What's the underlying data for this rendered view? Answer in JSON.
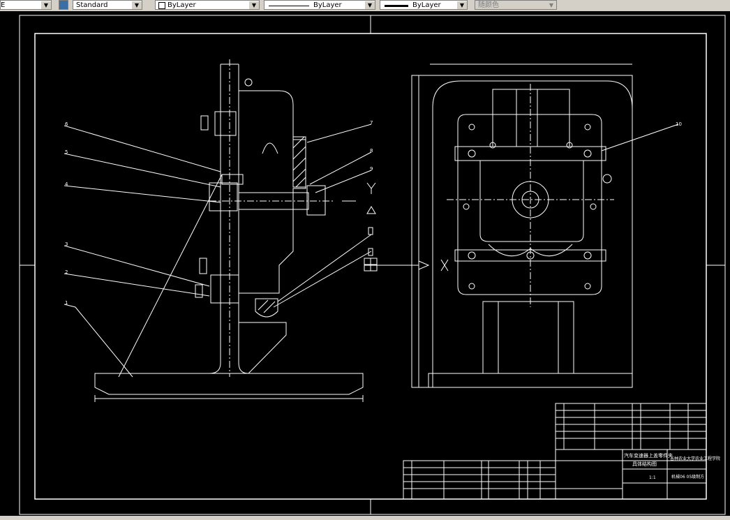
{
  "toolbar": {
    "first_dropdown_fragment": "E",
    "text_style_value": "Standard",
    "layer_color_value": "ByLayer",
    "linetype_value": "ByLayer",
    "lineweight_value": "ByLayer",
    "plot_style_value": "随颜色"
  },
  "drawing": {
    "colors": {
      "background": "#000000",
      "lines": "#ffffff"
    },
    "part_numbers": [
      "6",
      "5",
      "4",
      "3",
      "2",
      "1",
      "7",
      "8",
      "9",
      "10"
    ],
    "title_block": {
      "school": "吉林农业大学农业工程学院",
      "class": "机械06 05级制方",
      "title_line1": "汽车变速器上盖零件夹",
      "title_line2": "具体结构图",
      "scale": "1:1"
    }
  }
}
